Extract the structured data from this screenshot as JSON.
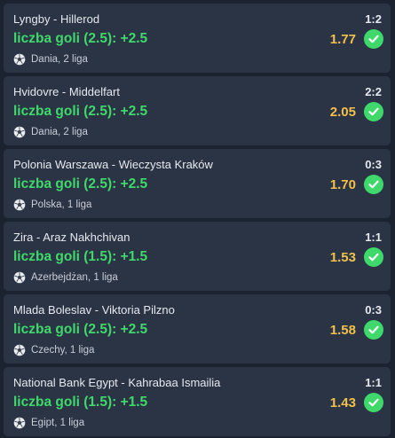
{
  "colors": {
    "background": "#1c2330",
    "card": "#2b3445",
    "pick_green": "#3fd96b",
    "odds_yellow": "#f2c04b",
    "text": "#e6e9ef"
  },
  "icons": {
    "league": "football-icon",
    "result": "check-circle-icon"
  },
  "bets": [
    {
      "teams": "Lyngby - Hillerod",
      "score": "1:2",
      "pick": "liczba goli (2.5): +2.5",
      "odds": "1.77",
      "league": "Dania, 2 liga"
    },
    {
      "teams": "Hvidovre - Middelfart",
      "score": "2:2",
      "pick": "liczba goli (2.5): +2.5",
      "odds": "2.05",
      "league": "Dania, 2 liga"
    },
    {
      "teams": "Polonia Warszawa - Wieczysta Kraków",
      "score": "0:3",
      "pick": "liczba goli (2.5): +2.5",
      "odds": "1.70",
      "league": "Polska, 1 liga"
    },
    {
      "teams": "Zira - Araz Nakhchivan",
      "score": "1:1",
      "pick": "liczba goli (1.5): +1.5",
      "odds": "1.53",
      "league": "Azerbejdżan, 1 liga"
    },
    {
      "teams": "Mlada Boleslav - Viktoria Pilzno",
      "score": "0:3",
      "pick": "liczba goli (2.5): +2.5",
      "odds": "1.58",
      "league": "Czechy, 1 liga"
    },
    {
      "teams": "National Bank Egypt - Kahrabaa Ismailia",
      "score": "1:1",
      "pick": "liczba goli (1.5): +1.5",
      "odds": "1.43",
      "league": "Egipt, 1 liga"
    }
  ]
}
